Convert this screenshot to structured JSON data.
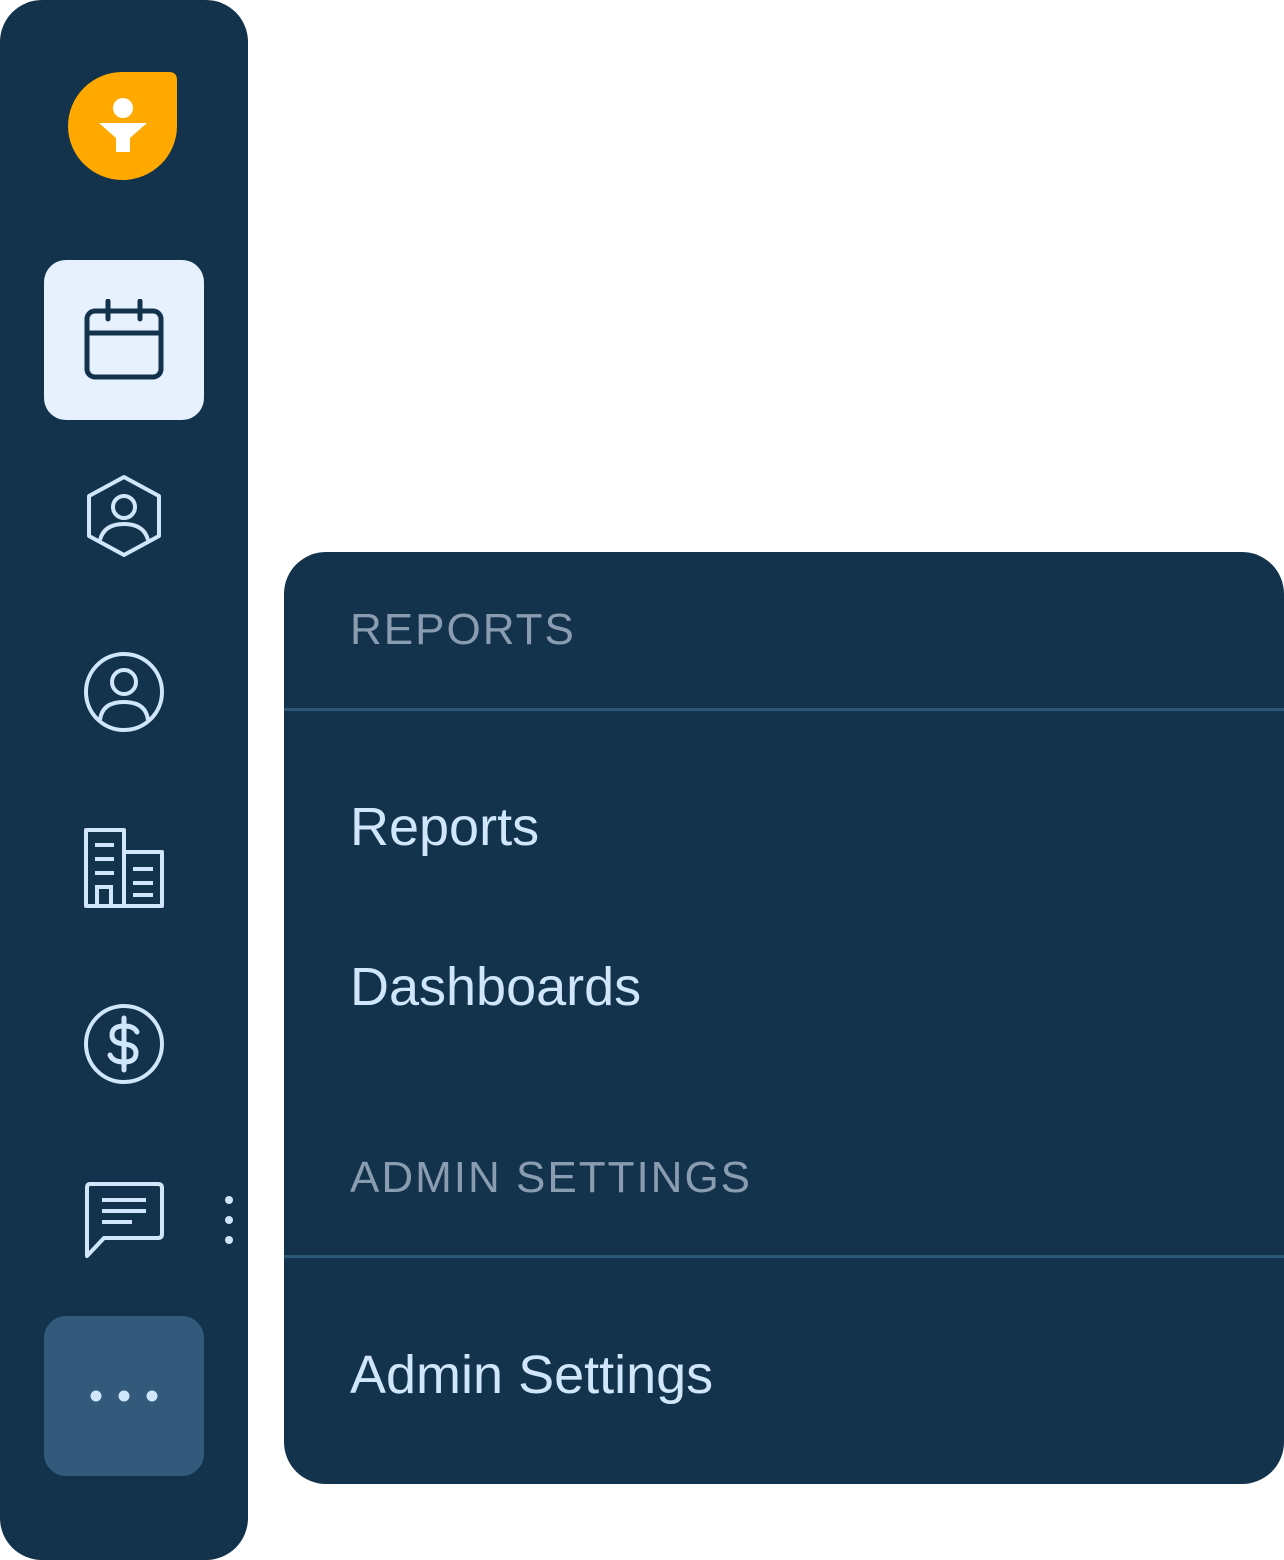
{
  "colors": {
    "sidebar_bg": "#13334c",
    "active_item_bg": "#e6f1fd",
    "more_item_bg": "#335a7b",
    "logo_orange": "#ffa800",
    "icon_stroke": "#cfe6fb",
    "header_text": "#8a9db0",
    "item_text": "#cfe6fb"
  },
  "sidebar": {
    "logo": "funnel-logo-icon",
    "items": [
      {
        "name": "calendar",
        "icon": "calendar-icon",
        "active": true
      },
      {
        "name": "contacts",
        "icon": "user-hexagon-icon"
      },
      {
        "name": "profile",
        "icon": "user-circle-icon"
      },
      {
        "name": "companies",
        "icon": "building-icon"
      },
      {
        "name": "billing",
        "icon": "dollar-circle-icon"
      },
      {
        "name": "messages",
        "icon": "chat-icon"
      },
      {
        "name": "more",
        "icon": "ellipsis-icon"
      }
    ],
    "resize_handle": "vertical-dots-icon"
  },
  "menu": {
    "reports_header": "REPORTS",
    "reports_item": "Reports",
    "dashboards_item": "Dashboards",
    "admin_header": "ADMIN SETTINGS",
    "admin_item": "Admin Settings"
  }
}
